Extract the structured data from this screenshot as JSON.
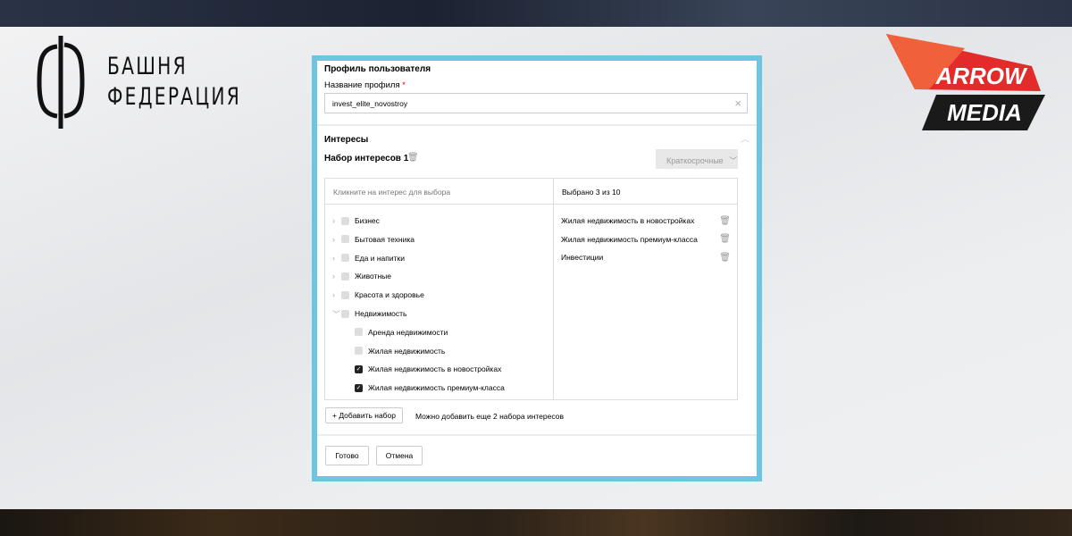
{
  "brand_left": {
    "line1": "БАШНЯ",
    "line2": "ФЕДЕРАЦИЯ"
  },
  "brand_right": {
    "line1": "ARROW",
    "line2": "MEDIA"
  },
  "form": {
    "title": "Профиль пользователя",
    "name_label": "Название профиля",
    "required_mark": "*",
    "name_value": "invest_elite_novostroy",
    "interests_title": "Интересы",
    "set_title": "Набор интересов 1",
    "term_select": "Краткосрочные",
    "left_header": "Кликните на интерес для выбора",
    "right_header": "Выбрано 3 из 10",
    "tree": [
      {
        "label": "Бизнес",
        "expanded": false,
        "checked": false
      },
      {
        "label": "Бытовая техника",
        "expanded": false,
        "checked": false
      },
      {
        "label": "Еда и напитки",
        "expanded": false,
        "checked": false
      },
      {
        "label": "Животные",
        "expanded": false,
        "checked": false
      },
      {
        "label": "Красота и здоровье",
        "expanded": false,
        "checked": false
      },
      {
        "label": "Недвижимость",
        "expanded": true,
        "checked": false
      }
    ],
    "subtree": [
      {
        "label": "Аренда недвижимости",
        "checked": false
      },
      {
        "label": "Жилая недвижимость",
        "checked": false
      },
      {
        "label": "Жилая недвижимость в новостройках",
        "checked": true
      },
      {
        "label": "Жилая недвижимость премиум-класса",
        "checked": true
      }
    ],
    "selected": [
      "Жилая недвижимость в новостройках",
      "Жилая недвижимость премиум-класса",
      "Инвестиции"
    ],
    "add_set_label": "+ Добавить набор",
    "add_hint": "Можно добавить еще 2 набора интересов",
    "done_label": "Готово",
    "cancel_label": "Отмена"
  },
  "colors": {
    "panel_border": "#6cc6e2",
    "required": "#e0001a"
  }
}
